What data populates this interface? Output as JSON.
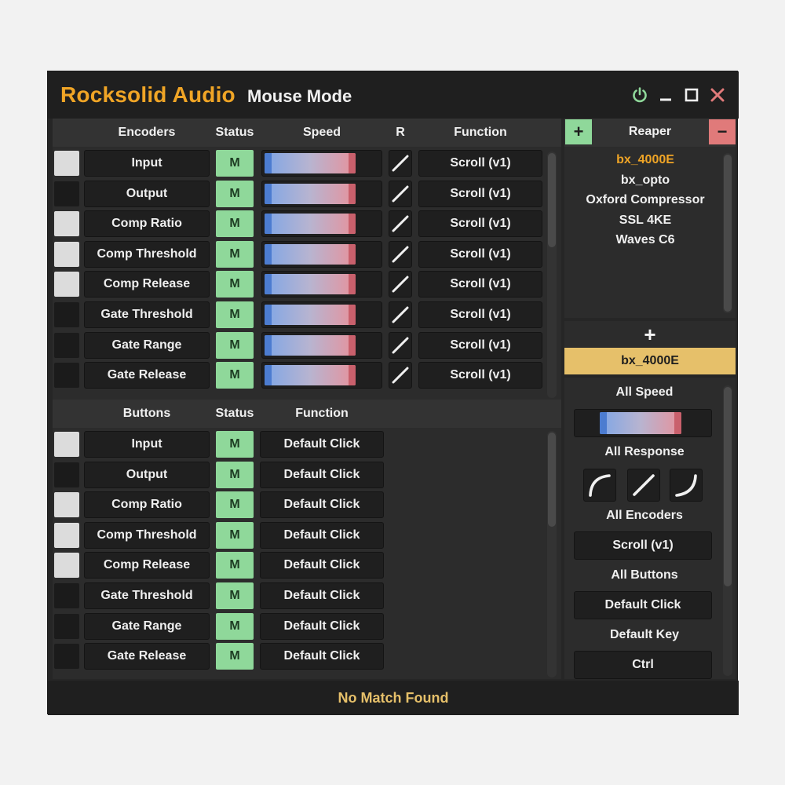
{
  "title": {
    "brand": "Rocksolid Audio",
    "mode": "Mouse Mode"
  },
  "window_controls": [
    "power-icon",
    "minimize-icon",
    "maximize-icon",
    "close-icon"
  ],
  "encoders": {
    "headers": {
      "name": "Encoders",
      "status": "Status",
      "speed": "Speed",
      "response": "R",
      "function": "Function"
    },
    "rows": [
      {
        "name": "Input",
        "status": "M",
        "function": "Scroll (v1)",
        "selected": true
      },
      {
        "name": "Output",
        "status": "M",
        "function": "Scroll (v1)",
        "selected": false
      },
      {
        "name": "Comp Ratio",
        "status": "M",
        "function": "Scroll (v1)",
        "selected": true
      },
      {
        "name": "Comp Threshold",
        "status": "M",
        "function": "Scroll (v1)",
        "selected": true
      },
      {
        "name": "Comp Release",
        "status": "M",
        "function": "Scroll (v1)",
        "selected": true
      },
      {
        "name": "Gate Threshold",
        "status": "M",
        "function": "Scroll (v1)",
        "selected": false
      },
      {
        "name": "Gate Range",
        "status": "M",
        "function": "Scroll (v1)",
        "selected": false
      },
      {
        "name": "Gate Release",
        "status": "M",
        "function": "Scroll (v1)",
        "selected": false
      }
    ]
  },
  "buttons": {
    "headers": {
      "name": "Buttons",
      "status": "Status",
      "function": "Function"
    },
    "rows": [
      {
        "name": "Input",
        "status": "M",
        "function": "Default Click",
        "selected": true
      },
      {
        "name": "Output",
        "status": "M",
        "function": "Default Click",
        "selected": false
      },
      {
        "name": "Comp Ratio",
        "status": "M",
        "function": "Default Click",
        "selected": true
      },
      {
        "name": "Comp Threshold",
        "status": "M",
        "function": "Default Click",
        "selected": true
      },
      {
        "name": "Comp Release",
        "status": "M",
        "function": "Default Click",
        "selected": true
      },
      {
        "name": "Gate Threshold",
        "status": "M",
        "function": "Default Click",
        "selected": false
      },
      {
        "name": "Gate Range",
        "status": "M",
        "function": "Default Click",
        "selected": false
      },
      {
        "name": "Gate Release",
        "status": "M",
        "function": "Default Click",
        "selected": false
      }
    ]
  },
  "sidebar": {
    "daw": "Reaper",
    "add_label": "+",
    "remove_label": "−",
    "plugins": [
      "bx_4000E",
      "bx_opto",
      "Oxford Compressor",
      "SSL 4KE",
      "Waves C6"
    ],
    "selected_plugin": "bx_4000E",
    "add_plugin_label": "+",
    "active_plugin": "bx_4000E",
    "all_speed_label": "All Speed",
    "all_response_label": "All Response",
    "all_encoders_label": "All Encoders",
    "all_encoders_value": "Scroll (v1)",
    "all_buttons_label": "All Buttons",
    "all_buttons_value": "Default Click",
    "default_key_label": "Default Key",
    "default_key_value": "Ctrl"
  },
  "status_message": "No Match Found",
  "colors": {
    "brand": "#f0a526",
    "status_green": "#8fd89a",
    "add_green": "#8fd89a",
    "remove_red": "#e07a7a",
    "active_plugin": "#e6c06a",
    "status_text": "#e6c06a"
  }
}
